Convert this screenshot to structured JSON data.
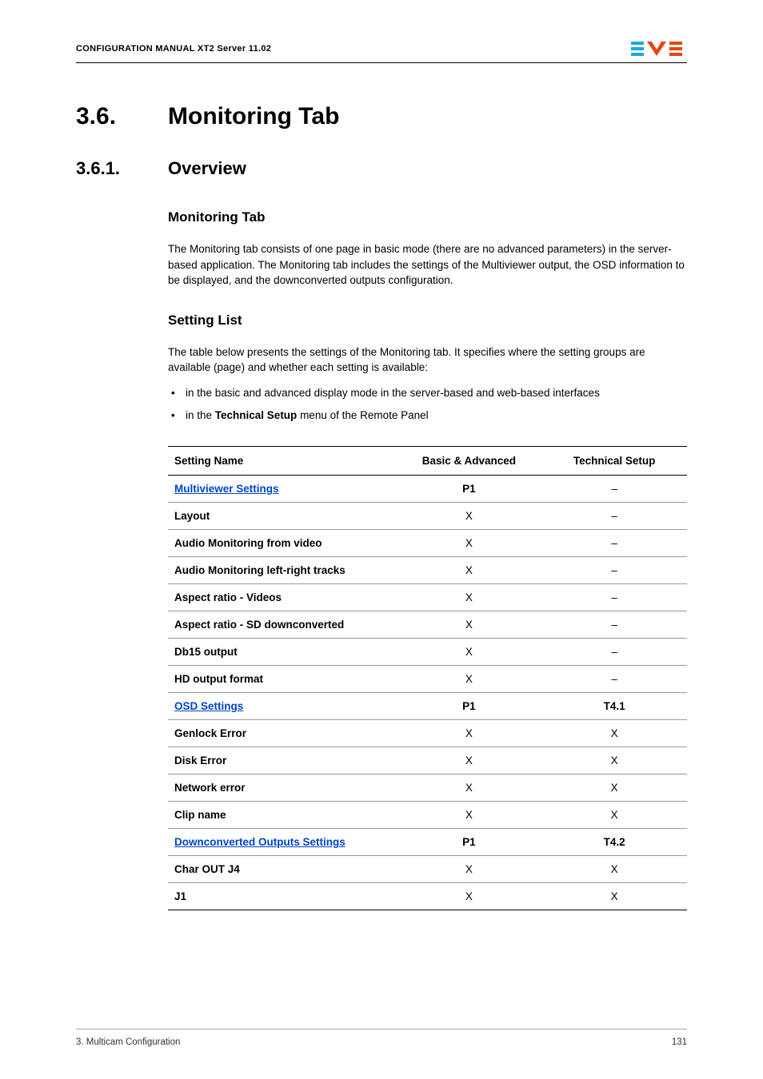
{
  "header": {
    "title": "CONFIGURATION MANUAL  XT2 Server 11.02"
  },
  "section": {
    "num": "3.6.",
    "heading": "Monitoring Tab"
  },
  "subsection": {
    "num": "3.6.1.",
    "heading": "Overview"
  },
  "h3a": "Monitoring Tab",
  "para1": "The Monitoring tab consists of one page in basic mode (there are no advanced parameters) in the server-based application. The Monitoring tab includes the settings of the Multiviewer output, the OSD information to be displayed, and the downconverted outputs configuration.",
  "h3b": "Setting List",
  "para2": "The table below presents the settings of the Monitoring tab. It specifies where the setting groups are available (page) and whether each setting is available:",
  "bullet1": "in the basic and advanced display mode in the server-based and web-based interfaces",
  "bullet2_pre": "in the ",
  "bullet2_bold": "Technical Setup",
  "bullet2_post": " menu of the Remote Panel",
  "table": {
    "headers": {
      "col1": "Setting Name",
      "col2": "Basic & Advanced",
      "col3": "Technical Setup"
    },
    "rows": [
      {
        "name": "Multiviewer Settings",
        "basic": "P1",
        "tech": "–",
        "link": true,
        "bold": true
      },
      {
        "name": "Layout",
        "basic": "X",
        "tech": "–",
        "link": false,
        "bold": true
      },
      {
        "name": "Audio Monitoring from video",
        "basic": "X",
        "tech": "–",
        "link": false,
        "bold": true
      },
      {
        "name": "Audio Monitoring left-right tracks",
        "basic": "X",
        "tech": "–",
        "link": false,
        "bold": true
      },
      {
        "name": "Aspect ratio - Videos",
        "basic": "X",
        "tech": "–",
        "link": false,
        "bold": true
      },
      {
        "name": "Aspect ratio - SD downconverted",
        "basic": "X",
        "tech": "–",
        "link": false,
        "bold": true
      },
      {
        "name": "Db15 output",
        "basic": "X",
        "tech": "–",
        "link": false,
        "bold": true
      },
      {
        "name": "HD output format",
        "basic": "X",
        "tech": "–",
        "link": false,
        "bold": true
      },
      {
        "name": "OSD Settings",
        "basic": "P1",
        "tech": "T4.1",
        "link": true,
        "bold": true
      },
      {
        "name": "Genlock Error",
        "basic": "X",
        "tech": "X",
        "link": false,
        "bold": true
      },
      {
        "name": "Disk Error",
        "basic": "X",
        "tech": "X",
        "link": false,
        "bold": true
      },
      {
        "name": "Network error",
        "basic": "X",
        "tech": "X",
        "link": false,
        "bold": true
      },
      {
        "name": "Clip name",
        "basic": "X",
        "tech": "X",
        "link": false,
        "bold": true
      },
      {
        "name": "Downconverted Outputs Settings",
        "basic": "P1",
        "tech": "T4.2",
        "link": true,
        "bold": true
      },
      {
        "name": "Char OUT J4",
        "basic": "X",
        "tech": "X",
        "link": false,
        "bold": true
      },
      {
        "name": "J1",
        "basic": "X",
        "tech": "X",
        "link": false,
        "bold": true
      }
    ]
  },
  "footer": {
    "left": "3. Multicam Configuration",
    "right": "131"
  }
}
